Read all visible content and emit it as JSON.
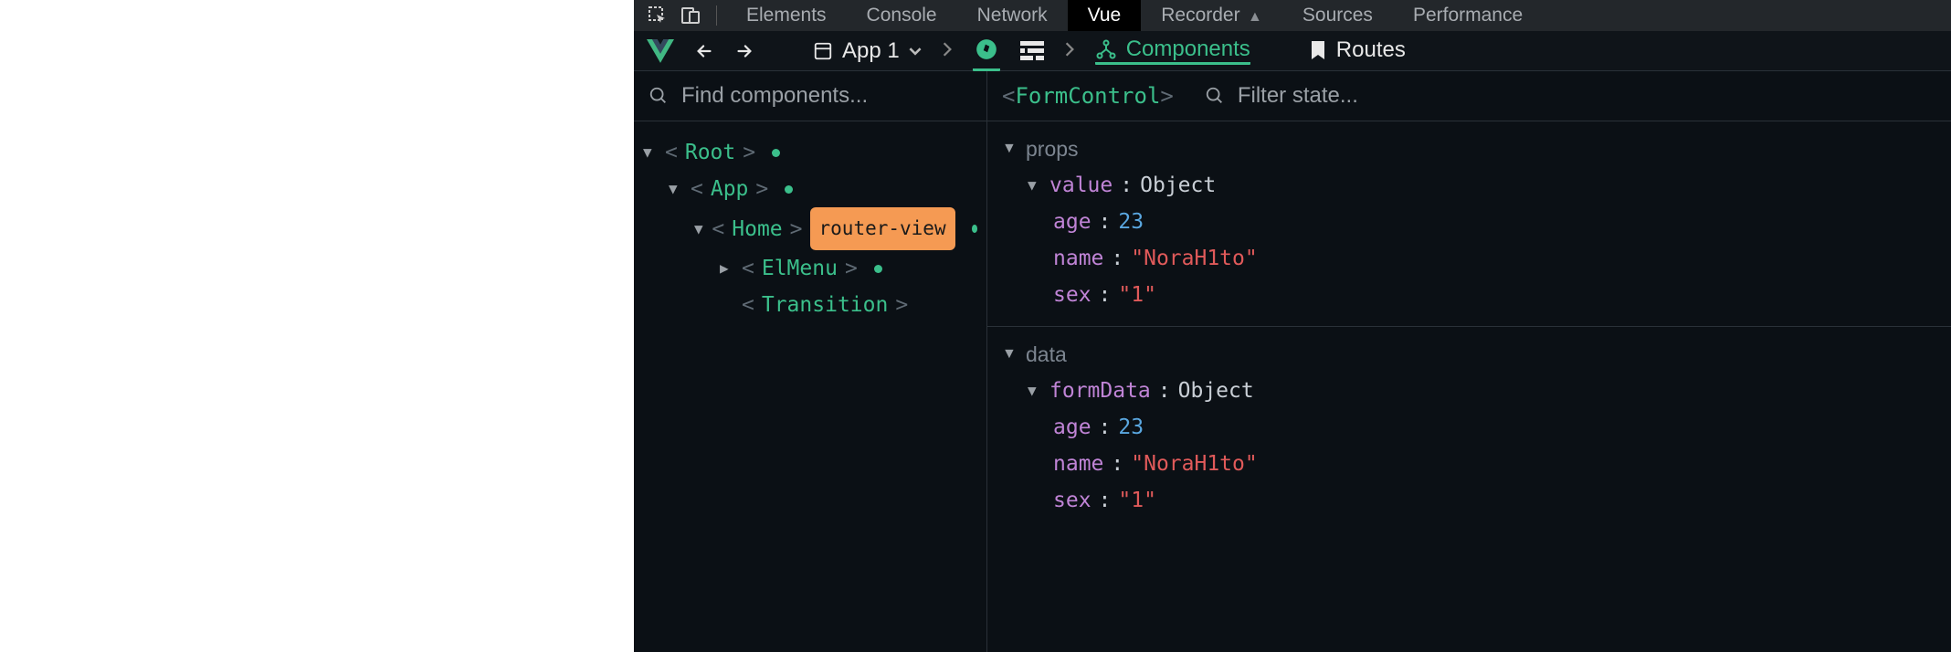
{
  "devtools_tabs": {
    "elements": "Elements",
    "console": "Console",
    "network": "Network",
    "vue": "Vue",
    "recorder": "Recorder",
    "sources": "Sources",
    "performance": "Performance"
  },
  "toolbar": {
    "app_selector": "App 1",
    "tab_components": "Components",
    "tab_routes": "Routes"
  },
  "tree_search": {
    "placeholder": "Find components..."
  },
  "component_tree": {
    "root": "Root",
    "app": "App",
    "home": "Home",
    "home_badge": "router-view",
    "elmenu": "ElMenu",
    "transition": "Transition"
  },
  "inspector": {
    "selected": "FormControl",
    "filter_placeholder": "Filter state...",
    "sections": {
      "props": {
        "title": "props",
        "value_label": "value",
        "value_type": "Object",
        "fields": {
          "age_key": "age",
          "age_val": "23",
          "name_key": "name",
          "name_val": "\"NoraH1to\"",
          "sex_key": "sex",
          "sex_val": "\"1\""
        }
      },
      "data": {
        "title": "data",
        "value_label": "formData",
        "value_type": "Object",
        "fields": {
          "age_key": "age",
          "age_val": "23",
          "name_key": "name",
          "name_val": "\"NoraH1to\"",
          "sex_key": "sex",
          "sex_val": "\"1\""
        }
      }
    }
  }
}
